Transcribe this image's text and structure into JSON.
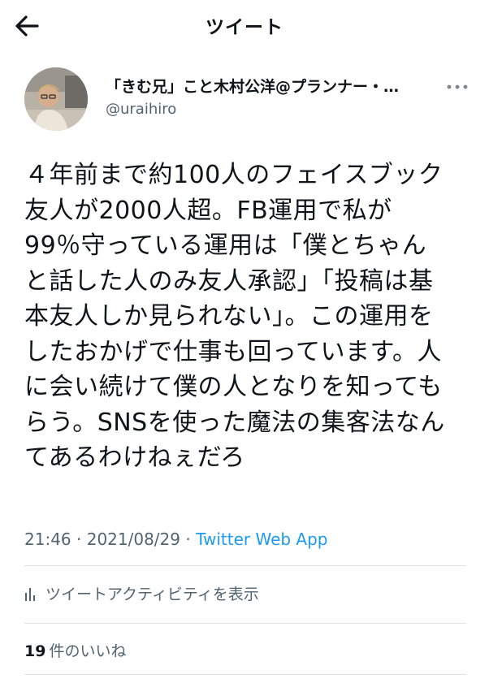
{
  "header": {
    "title": "ツイート"
  },
  "author": {
    "display_name": "「きむ兄」こと木村公洋@プランナー・…",
    "handle": "@uraihiro"
  },
  "tweet": {
    "lines": [
      "４年前まで約100人のフェイスブック",
      "友人が2000人超。FB運用で私が",
      "99％守っている運用は「僕とちゃん",
      "と話した人のみ友人承認」「投稿は基",
      "本友人しか見られない」。この運用を",
      "したおかげで仕事も回っています。人",
      "に会い続けて僕の人となりを知っても",
      "らう。SNSを使った魔法の集客法なん",
      "てあるわけねぇだろ"
    ]
  },
  "meta": {
    "time": "21:46",
    "separator_1": " · ",
    "date": "2021/08/29",
    "separator_2": " · ",
    "source": "Twitter Web App"
  },
  "activity": {
    "label": "ツイートアクティビティを表示"
  },
  "likes": {
    "count": "19",
    "label": "件のいいね"
  },
  "icons": {
    "back": "arrow-left-icon",
    "more": "more-horizontal-icon",
    "activity": "bar-chart-icon"
  },
  "colors": {
    "link": "#1d9bf0",
    "secondary_text": "#536471",
    "divider": "#dfe3e6"
  }
}
